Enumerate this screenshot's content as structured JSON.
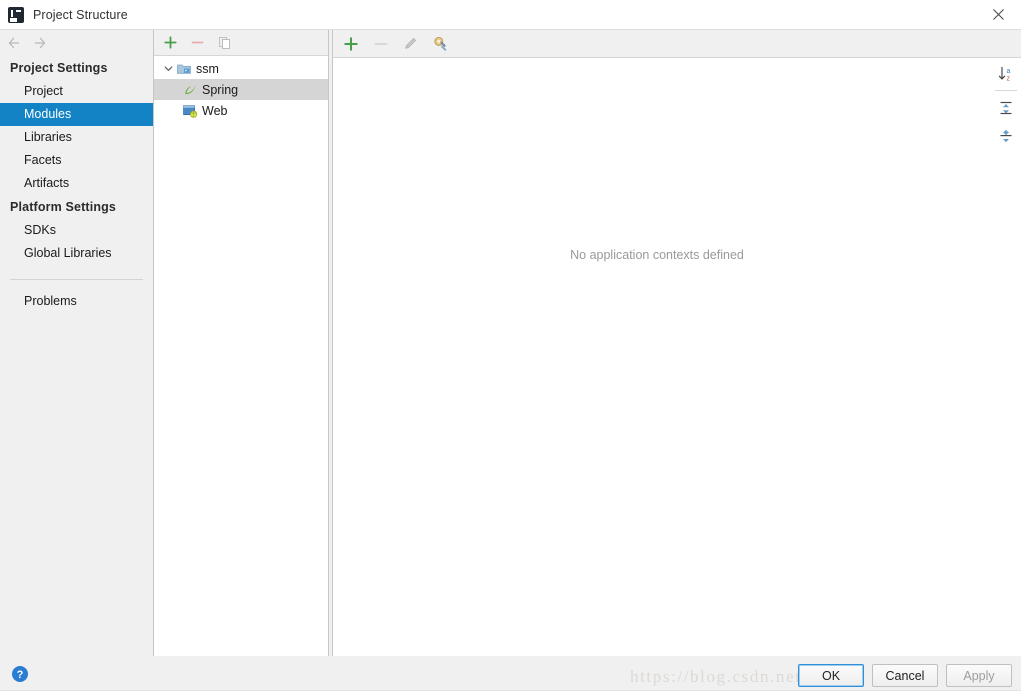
{
  "window": {
    "title": "Project Structure",
    "logo_icon": "intellij-idea-logo",
    "close_icon": "close-icon"
  },
  "navigation": {
    "back_icon": "arrow-left-icon",
    "forward_icon": "arrow-right-icon"
  },
  "sidebar": {
    "groups": [
      {
        "label": "Project Settings",
        "items": [
          {
            "label": "Project",
            "selected": false
          },
          {
            "label": "Modules",
            "selected": true
          },
          {
            "label": "Libraries",
            "selected": false
          },
          {
            "label": "Facets",
            "selected": false
          },
          {
            "label": "Artifacts",
            "selected": false
          }
        ]
      },
      {
        "label": "Platform Settings",
        "items": [
          {
            "label": "SDKs",
            "selected": false
          },
          {
            "label": "Global Libraries",
            "selected": false
          }
        ]
      }
    ],
    "problems": {
      "label": "Problems"
    }
  },
  "tree_panel": {
    "toolbar": [
      {
        "name": "add-module-button",
        "icon": "plus-icon",
        "enabled": true
      },
      {
        "name": "remove-module-button",
        "icon": "minus-icon",
        "enabled": false
      },
      {
        "name": "copy-module-button",
        "icon": "copy-icon",
        "enabled": false
      }
    ],
    "nodes": [
      {
        "label": "ssm",
        "icon": "module-folder-icon",
        "level": 0,
        "expanded": true,
        "selected": false
      },
      {
        "label": "Spring",
        "icon": "spring-leaf-icon",
        "level": 1,
        "selected": true
      },
      {
        "label": "Web",
        "icon": "web-facet-icon",
        "level": 1,
        "selected": false
      }
    ]
  },
  "detail_panel": {
    "toolbar": [
      {
        "name": "add-context-button",
        "icon": "plus-icon",
        "enabled": true
      },
      {
        "name": "remove-context-button",
        "icon": "minus-icon",
        "enabled": false
      },
      {
        "name": "edit-context-button",
        "icon": "pencil-icon",
        "enabled": false
      },
      {
        "name": "configure-button",
        "icon": "wrench-config-icon",
        "enabled": true
      }
    ],
    "empty_message": "No application contexts defined",
    "side_toolbar": [
      {
        "name": "sort-alphabetically-button",
        "icon": "sort-az-icon"
      },
      {
        "name": "expand-all-button",
        "icon": "expand-all-icon"
      },
      {
        "name": "collapse-all-button",
        "icon": "collapse-all-icon"
      }
    ]
  },
  "footer": {
    "help_icon": "help-circle-icon",
    "watermark": "https://blog.csdn.net",
    "buttons": [
      {
        "label": "OK",
        "style": "default"
      },
      {
        "label": "Cancel",
        "style": "normal"
      },
      {
        "label": "Apply",
        "style": "disabled"
      }
    ]
  },
  "colors": {
    "selection_blue": "#1383c6",
    "tree_selection_gray": "#d5d5d5",
    "accent_green": "#4a9e4a",
    "panel_bg": "#f0f0f0"
  }
}
